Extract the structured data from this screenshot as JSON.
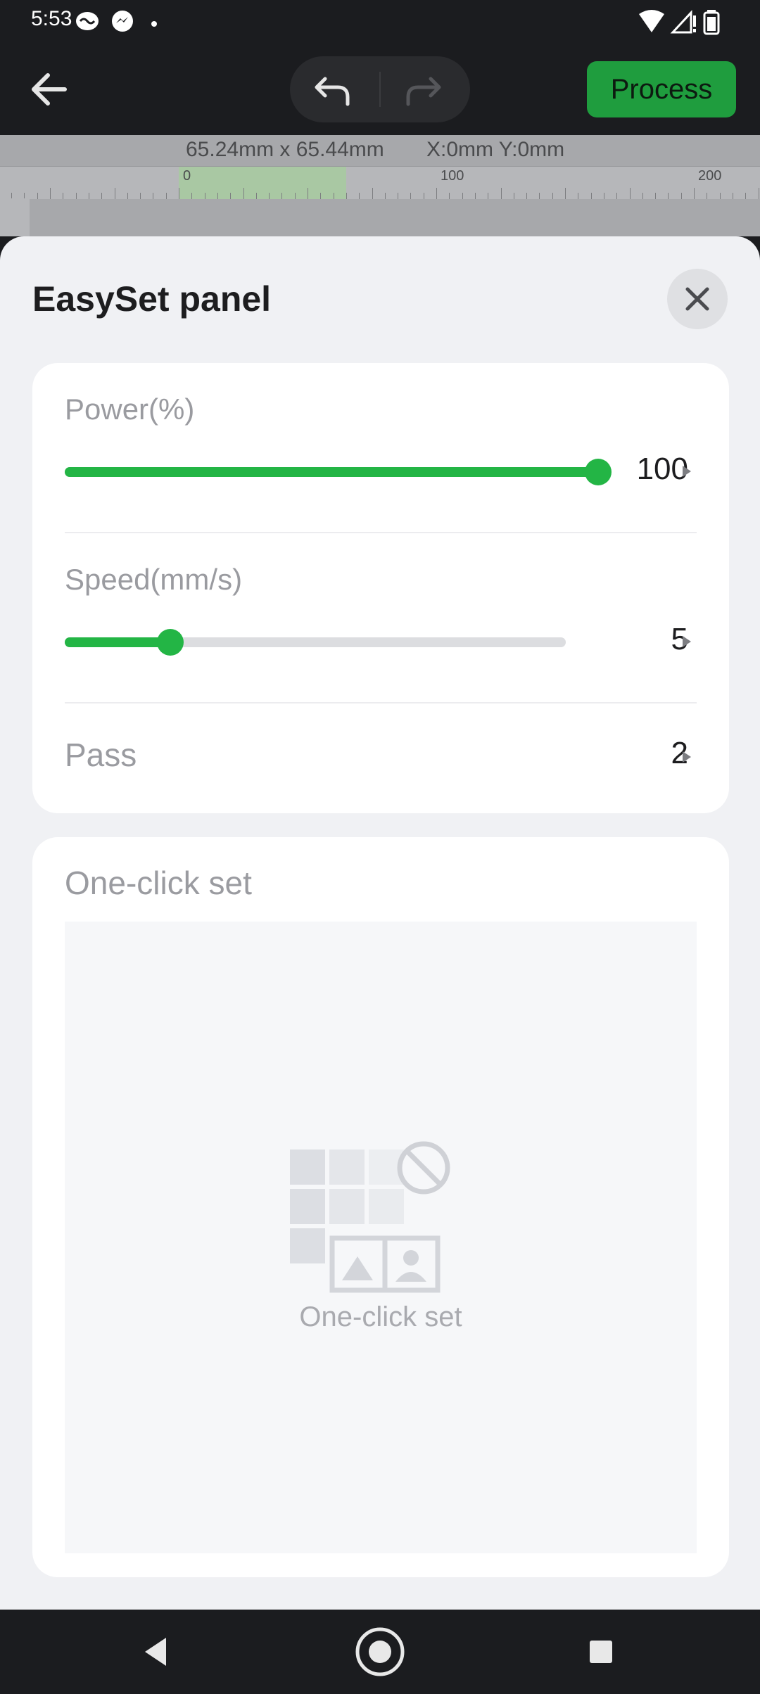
{
  "status_bar": {
    "time": "5:53"
  },
  "toolbar": {
    "process_label": "Process"
  },
  "canvas": {
    "dimensions": "65.24mm x 65.44mm",
    "position": "X:0mm Y:0mm",
    "ruler_labels": [
      "0",
      "100",
      "200"
    ]
  },
  "panel": {
    "title": "EasySet panel",
    "power": {
      "label": "Power(%)",
      "value": "100",
      "fraction": 1.0
    },
    "speed": {
      "label": "Speed(mm/s)",
      "value": "5",
      "fraction": 0.21
    },
    "pass": {
      "label": "Pass",
      "value": "2"
    },
    "one_click": {
      "title": "One-click set",
      "empty_text": "One-click set"
    }
  },
  "colors": {
    "accent": "#23b545",
    "process_button": "#1f9d3e",
    "sheet_bg": "#f0f1f4"
  },
  "icons": [
    "back-arrow-icon",
    "undo-icon",
    "redo-icon",
    "close-icon",
    "nav-back-icon",
    "nav-home-icon",
    "nav-recents-icon"
  ]
}
